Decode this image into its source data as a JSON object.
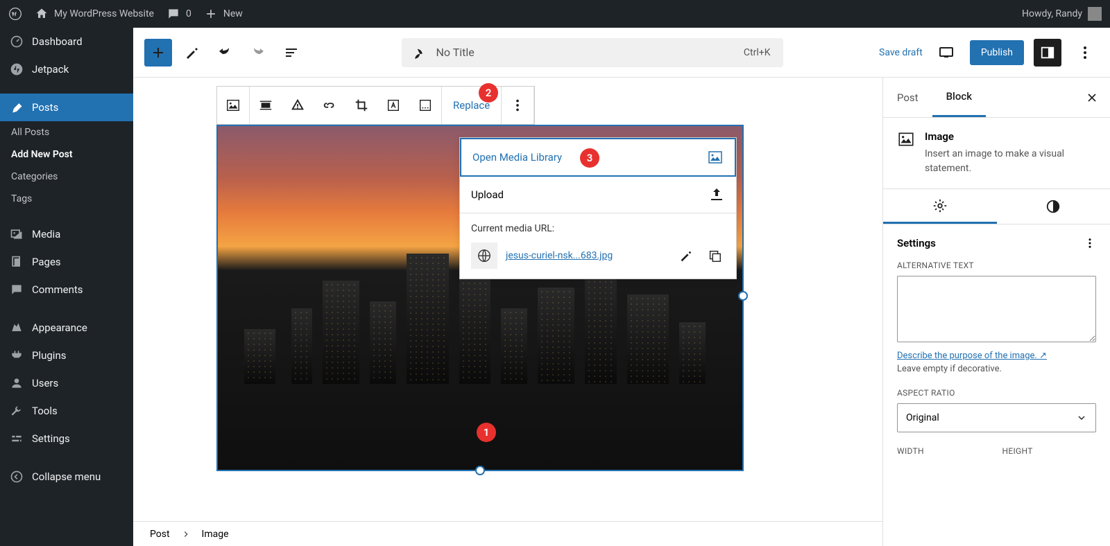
{
  "adminbar": {
    "site_name": "My WordPress Website",
    "comments": "0",
    "new": "New",
    "howdy": "Howdy, Randy"
  },
  "sidebar": {
    "dashboard": "Dashboard",
    "jetpack": "Jetpack",
    "posts": "Posts",
    "posts_sub": {
      "all": "All Posts",
      "add": "Add New Post",
      "categories": "Categories",
      "tags": "Tags"
    },
    "media": "Media",
    "pages": "Pages",
    "comments": "Comments",
    "appearance": "Appearance",
    "plugins": "Plugins",
    "users": "Users",
    "tools": "Tools",
    "settings": "Settings",
    "collapse": "Collapse menu"
  },
  "header": {
    "title": "No Title",
    "shortcut": "Ctrl+K",
    "save_draft": "Save draft",
    "publish": "Publish"
  },
  "toolbar": {
    "replace": "Replace"
  },
  "dropdown": {
    "open_media": "Open Media Library",
    "upload": "Upload",
    "url_label": "Current media URL:",
    "url_text": "jesus-curiel-nsk...683.jpg"
  },
  "badges": {
    "b1": "1",
    "b2": "2",
    "b3": "3"
  },
  "rpanel": {
    "tab_post": "Post",
    "tab_block": "Block",
    "block_title": "Image",
    "block_desc": "Insert an image to make a visual statement.",
    "settings": "Settings",
    "alt_label": "ALTERNATIVE TEXT",
    "alt_link": "Describe the purpose of the image. ↗",
    "alt_hint": "Leave empty if decorative.",
    "ratio_label": "ASPECT RATIO",
    "ratio_value": "Original",
    "width": "WIDTH",
    "height": "HEIGHT"
  },
  "breadcrumb": {
    "post": "Post",
    "image": "Image"
  }
}
